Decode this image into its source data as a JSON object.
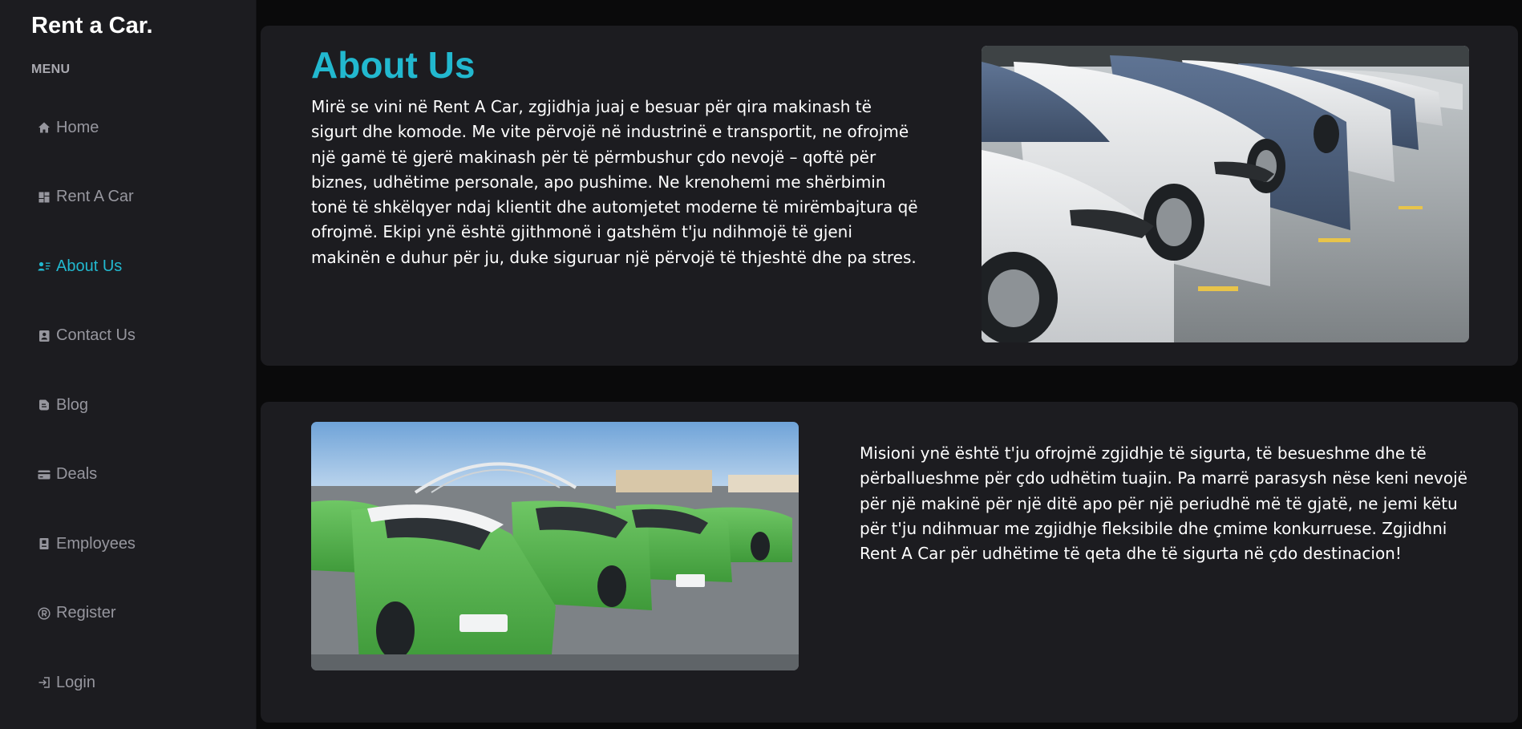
{
  "sidebar": {
    "brand": "Rent a Car.",
    "menu_label": "MENU",
    "items": [
      {
        "label": "Home",
        "icon": "home-icon",
        "active": false
      },
      {
        "label": "Rent A Car",
        "icon": "dashboard-icon",
        "active": false
      },
      {
        "label": "About Us",
        "icon": "people-list-icon",
        "active": true
      },
      {
        "label": "Contact Us",
        "icon": "contact-card-icon",
        "active": false
      },
      {
        "label": "Blog",
        "icon": "blog-icon",
        "active": false
      },
      {
        "label": "Deals",
        "icon": "credit-card-icon",
        "active": false
      },
      {
        "label": "Employees",
        "icon": "badge-icon",
        "active": false
      },
      {
        "label": "Register",
        "icon": "registered-icon",
        "active": false
      },
      {
        "label": "Login",
        "icon": "login-icon",
        "active": false
      }
    ]
  },
  "about": {
    "title": "About Us",
    "text": "Mirë se vini në Rent A Car, zgjidhja juaj e besuar për qira makinash të sigurt dhe komode. Me vite përvojë në industrinë e transportit, ne ofrojmë një gamë të gjerë makinash për të përmbushur çdo nevojë – qoftë për biznes, udhëtime personale, apo pushime. Ne krenohemi me shërbimin tonë të shkëlqyer ndaj klientit dhe automjetet moderne të mirëmbajtura që ofrojmë. Ekipi ynë është gjithmonë i gatshëm t'ju ndihmojë të gjeni makinën e duhur për ju, duke siguruar një përvojë të thjeshtë dhe pa stres."
  },
  "mission": {
    "text": "Misioni ynë është t'ju ofrojmë zgjidhje të sigurta, të besueshme dhe të përballueshme për çdo udhëtim tuajin. Pa marrë parasysh nëse keni nevojë për një makinë për një ditë apo për një periudhë më të gjatë, ne jemi këtu për t'ju ndihmuar me zgjidhje fleksibile dhe çmime konkurruese. Zgjidhni Rent A Car për udhëtime të qeta dhe të sigurta në çdo destinacion!"
  },
  "colors": {
    "accent": "#22b8cf",
    "sidebar_bg": "#1c1c20",
    "page_bg": "#0a0a0b",
    "nav_text": "#96969e"
  }
}
